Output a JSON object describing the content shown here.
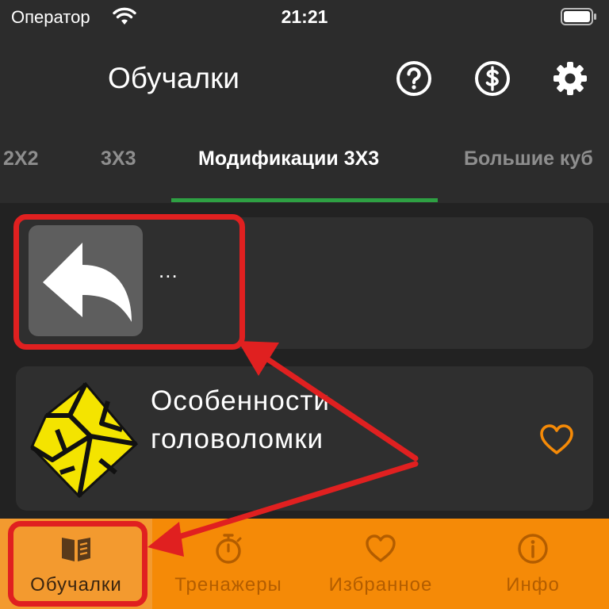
{
  "status_bar": {
    "carrier": "Оператор",
    "time": "21:21"
  },
  "header": {
    "title": "Обучалки",
    "icons": [
      "help-icon",
      "dollar-icon",
      "gear-icon"
    ]
  },
  "tabs": [
    {
      "label": "2X2",
      "active": false
    },
    {
      "label": "3X3",
      "active": false
    },
    {
      "label": "Модификации 3X3",
      "active": true
    },
    {
      "label": "Большие куб",
      "active": false
    }
  ],
  "cards": [
    {
      "ellipsis": "...",
      "icon": "back-arrow-icon"
    },
    {
      "title": "Особенности головоломки",
      "icon": "mirror-cube-icon",
      "favorite_icon": "heart-outline-icon"
    }
  ],
  "bottom_nav": [
    {
      "label": "Обучалки",
      "icon": "book-icon",
      "active": true
    },
    {
      "label": "Тренажеры",
      "icon": "stopwatch-icon",
      "active": false
    },
    {
      "label": "Избранное",
      "icon": "heart-icon",
      "active": false
    },
    {
      "label": "Инфо",
      "icon": "info-icon",
      "active": false
    }
  ],
  "colors": {
    "accent_green": "#2ea043",
    "nav_orange": "#f58a07",
    "annotation_red": "#e02020",
    "heart_orange": "#f58a07"
  }
}
